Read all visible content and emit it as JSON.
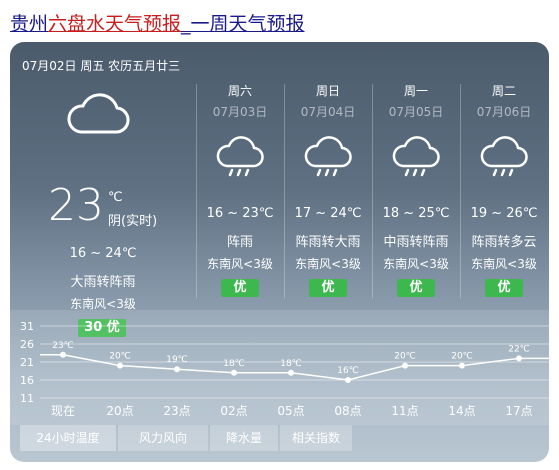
{
  "title": {
    "province": "贵州",
    "city": "六盘水天气预报",
    "sep": "_",
    "suffix": "一周天气预报"
  },
  "today": {
    "date_line": "07月02日 周五 农历五月廿三",
    "icon": "cloudy-icon",
    "temp": "23",
    "unit": "℃",
    "cond_now": "阴(实时)",
    "range": "16 ~ 24℃",
    "cond": "大雨转阵雨",
    "wind": "东南风<3级",
    "aqi": "30 优"
  },
  "forecast": [
    {
      "name": "周六",
      "date": "07月03日",
      "icon": "rain-icon",
      "range": "16 ~ 23℃",
      "cond": "阵雨",
      "wind": "东南风<3级",
      "aqi": "优"
    },
    {
      "name": "周日",
      "date": "07月04日",
      "icon": "rain-icon",
      "range": "17 ~ 24℃",
      "cond": "阵雨转大雨",
      "wind": "东南风<3级",
      "aqi": "优"
    },
    {
      "name": "周一",
      "date": "07月05日",
      "icon": "rain-icon",
      "range": "18 ~ 25℃",
      "cond": "中雨转阵雨",
      "wind": "东南风<3级",
      "aqi": "优"
    },
    {
      "name": "周二",
      "date": "07月06日",
      "icon": "rain-icon",
      "range": "19 ~ 26℃",
      "cond": "阵雨转多云",
      "wind": "东南风<3级",
      "aqi": "优"
    }
  ],
  "tabs": [
    "24小时温度",
    "风力风向",
    "降水量",
    "相关指数"
  ],
  "colors": {
    "aqi_good": "#3cb84e",
    "title_red": "#c81e1e",
    "title_blue": "#1a1a8c"
  },
  "chart_data": {
    "type": "line",
    "x": [
      "现在",
      "20点",
      "23点",
      "02点",
      "05点",
      "08点",
      "11点",
      "14点",
      "17点"
    ],
    "values": [
      23,
      20,
      19,
      18,
      18,
      16,
      20,
      20,
      22
    ],
    "labels": [
      "23℃",
      "20℃",
      "19℃",
      "18℃",
      "18℃",
      "16℃",
      "20℃",
      "20℃",
      "22℃"
    ],
    "y_ticks": [
      31,
      26,
      21,
      16,
      11
    ],
    "ylim": [
      11,
      31
    ],
    "grid": true
  }
}
